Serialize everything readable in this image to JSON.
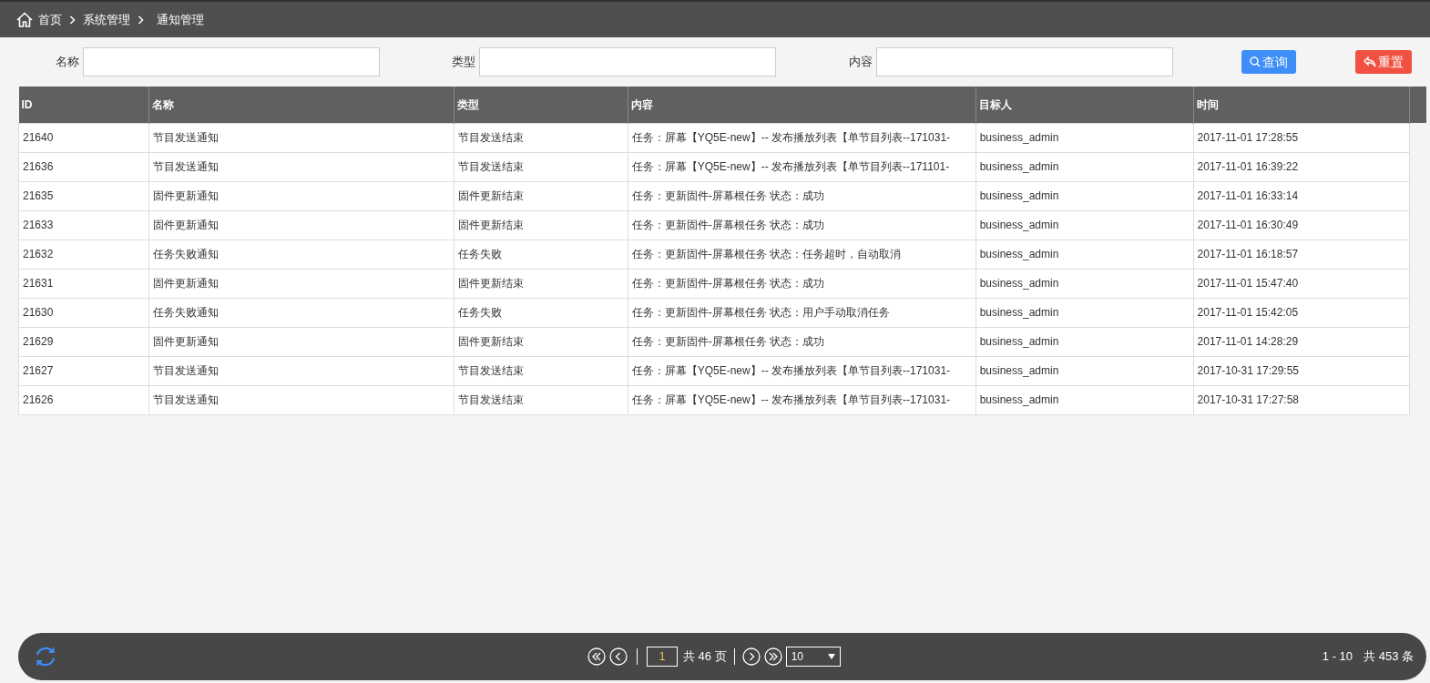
{
  "breadcrumb": [
    "首页",
    "系统管理",
    "通知管理"
  ],
  "filters": [
    {
      "label": "名称"
    },
    {
      "label": "类型"
    },
    {
      "label": "内容"
    }
  ],
  "buttons": [
    {
      "kind": "search",
      "label": "查询"
    },
    {
      "kind": "reset",
      "label": "重置"
    }
  ],
  "table": {
    "columns": [
      "ID",
      "名称",
      "类型",
      "内容",
      "目标人",
      "时间"
    ],
    "rows": [
      [
        "21640",
        "节目发送通知",
        "节目发送结束",
        "任务：屏幕【YQ5E-new】-- 发布播放列表【单节目列表--171031-",
        "business_admin",
        "2017-11-01 17:28:55"
      ],
      [
        "21636",
        "节目发送通知",
        "节目发送结束",
        "任务：屏幕【YQ5E-new】-- 发布播放列表【单节目列表--171101-",
        "business_admin",
        "2017-11-01 16:39:22"
      ],
      [
        "21635",
        "固件更新通知",
        "固件更新结束",
        "任务：更新固件-屏幕根任务 状态：成功",
        "business_admin",
        "2017-11-01 16:33:14"
      ],
      [
        "21633",
        "固件更新通知",
        "固件更新结束",
        "任务：更新固件-屏幕根任务 状态：成功",
        "business_admin",
        "2017-11-01 16:30:49"
      ],
      [
        "21632",
        "任务失败通知",
        "任务失败",
        "任务：更新固件-屏幕根任务 状态：任务超时，自动取消",
        "business_admin",
        "2017-11-01 16:18:57"
      ],
      [
        "21631",
        "固件更新通知",
        "固件更新结束",
        "任务：更新固件-屏幕根任务 状态：成功",
        "business_admin",
        "2017-11-01 15:47:40"
      ],
      [
        "21630",
        "任务失败通知",
        "任务失败",
        "任务：更新固件-屏幕根任务 状态：用户手动取消任务",
        "business_admin",
        "2017-11-01 15:42:05"
      ],
      [
        "21629",
        "固件更新通知",
        "固件更新结束",
        "任务：更新固件-屏幕根任务 状态：成功",
        "business_admin",
        "2017-11-01 14:28:29"
      ],
      [
        "21627",
        "节目发送通知",
        "节目发送结束",
        "任务：屏幕【YQ5E-new】-- 发布播放列表【单节目列表--171031-",
        "business_admin",
        "2017-10-31 17:29:55"
      ],
      [
        "21626",
        "节目发送通知",
        "节目发送结束",
        "任务：屏幕【YQ5E-new】-- 发布播放列表【单节目列表--171031-",
        "business_admin",
        "2017-10-31 17:27:58"
      ]
    ]
  },
  "pager": {
    "page": "1",
    "total_pages": "共 46 页",
    "page_size": "10",
    "range": "1 - 10",
    "total": "共 453 条"
  }
}
